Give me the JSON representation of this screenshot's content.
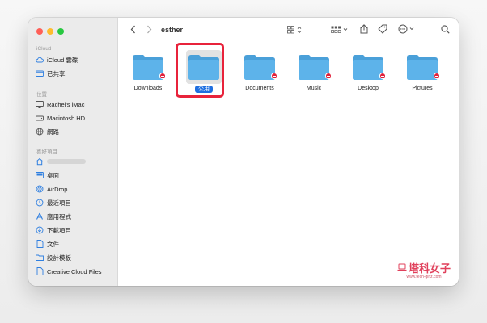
{
  "window": {
    "title": "esther"
  },
  "sidebar": {
    "sections": {
      "icloud": "iCloud",
      "locations": "位置",
      "favorites": "喜好項目"
    },
    "icloud_items": [
      {
        "label": "iCloud 雲碟",
        "icon": "cloud-icon"
      },
      {
        "label": "已共享",
        "icon": "shared-folder-icon"
      }
    ],
    "location_items": [
      {
        "label": "Rachel's iMac",
        "icon": "imac-icon"
      },
      {
        "label": "Macintosh HD",
        "icon": "hard-drive-icon"
      },
      {
        "label": "網路",
        "icon": "network-icon"
      }
    ],
    "favorite_items": [
      {
        "label": "",
        "icon": "home-icon"
      },
      {
        "label": "桌面",
        "icon": "desktop-icon"
      },
      {
        "label": "AirDrop",
        "icon": "airdrop-icon"
      },
      {
        "label": "最近項目",
        "icon": "clock-icon"
      },
      {
        "label": "應用程式",
        "icon": "apps-icon"
      },
      {
        "label": "下載項目",
        "icon": "download-icon"
      },
      {
        "label": "文件",
        "icon": "document-icon"
      },
      {
        "label": "設計模板",
        "icon": "folder-icon"
      },
      {
        "label": "Creative Cloud Files",
        "icon": "file-icon"
      }
    ]
  },
  "folders": [
    {
      "label": "Downloads",
      "locked": true,
      "selected": false
    },
    {
      "label": "公用",
      "locked": false,
      "selected": true
    },
    {
      "label": "Documents",
      "locked": true,
      "selected": false
    },
    {
      "label": "Music",
      "locked": true,
      "selected": false
    },
    {
      "label": "Desktop",
      "locked": true,
      "selected": false
    },
    {
      "label": "Pictures",
      "locked": true,
      "selected": false
    }
  ],
  "watermark": {
    "logo_text": "塔科女子",
    "site": "www.tech-girlz.com"
  },
  "colors": {
    "accent": "#1f6fe0",
    "folder": "#5db3ea",
    "folder_tab": "#4aa0d9",
    "highlight": "#e8233b",
    "sidebar_icon": "#2f7fe0"
  }
}
